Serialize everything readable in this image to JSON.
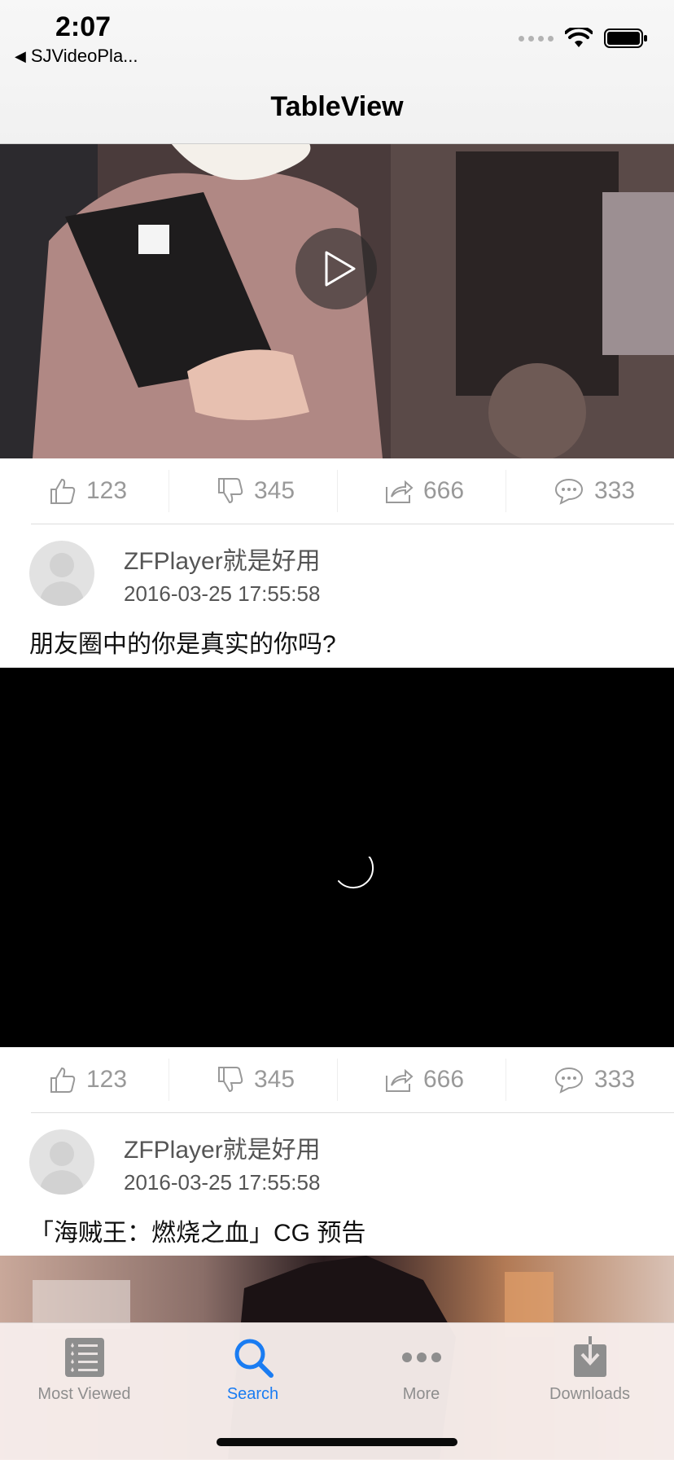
{
  "status_bar": {
    "time": "2:07",
    "back_app": "SJVideoPla..."
  },
  "nav": {
    "title": "TableView"
  },
  "posts": [
    {
      "actions": {
        "like": "123",
        "dislike": "345",
        "share": "666",
        "comment": "333"
      },
      "author": "ZFPlayer就是好用",
      "date": "2016-03-25 17:55:58",
      "caption": "朋友圈中的你是真实的你吗?"
    },
    {
      "actions": {
        "like": "123",
        "dislike": "345",
        "share": "666",
        "comment": "333"
      },
      "author": "ZFPlayer就是好用",
      "date": "2016-03-25 17:55:58",
      "caption": "「海贼王：燃烧之血」CG 预告"
    }
  ],
  "tabs": [
    {
      "label": "Most Viewed",
      "icon": "most-viewed-icon"
    },
    {
      "label": "Search",
      "icon": "search-icon"
    },
    {
      "label": "More",
      "icon": "more-icon"
    },
    {
      "label": "Downloads",
      "icon": "downloads-icon"
    }
  ],
  "colors": {
    "tab_active": "#1a7cf2",
    "tab_inactive": "#8e8e8e",
    "action_text": "#999999"
  }
}
